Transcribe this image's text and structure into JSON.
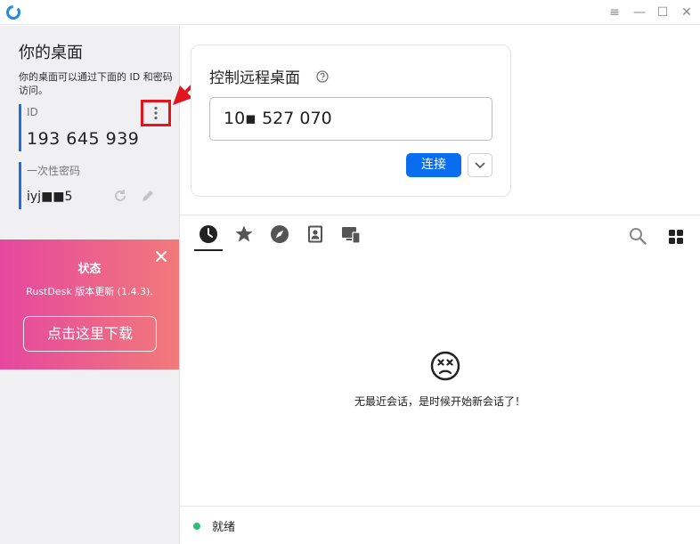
{
  "window": {
    "menu_glyph": "≡",
    "min_glyph": "—",
    "max_glyph": "☐",
    "close_glyph": "✕"
  },
  "sidebar": {
    "title": "你的桌面",
    "description": "你的桌面可以通过下面的 ID 和密码访问。",
    "id_label": "ID",
    "id_value": "193 645 939",
    "password_label": "一次性密码",
    "password_value": "iyj■■5"
  },
  "status_card": {
    "title": "状态",
    "message": "RustDesk 版本更新 (1.4.3).",
    "download_label": "点击这里下载"
  },
  "remote": {
    "title": "控制远程桌面",
    "id_input_value": "10▪ 527 070",
    "connect_label": "连接"
  },
  "tabs": [
    {
      "icon": "clock-icon"
    },
    {
      "icon": "star-icon"
    },
    {
      "icon": "compass-icon"
    },
    {
      "icon": "address-book-icon"
    },
    {
      "icon": "devices-icon"
    }
  ],
  "empty_state": {
    "message": "无最近会话，是时候开始新会话了！"
  },
  "statusbar": {
    "text": "就绪"
  },
  "colors": {
    "accent": "#0a6df0",
    "annotation": "#e2141c",
    "status_ok": "#2ec07a",
    "card_gradient_start": "#e5479f",
    "card_gradient_end": "#f27a7a"
  }
}
